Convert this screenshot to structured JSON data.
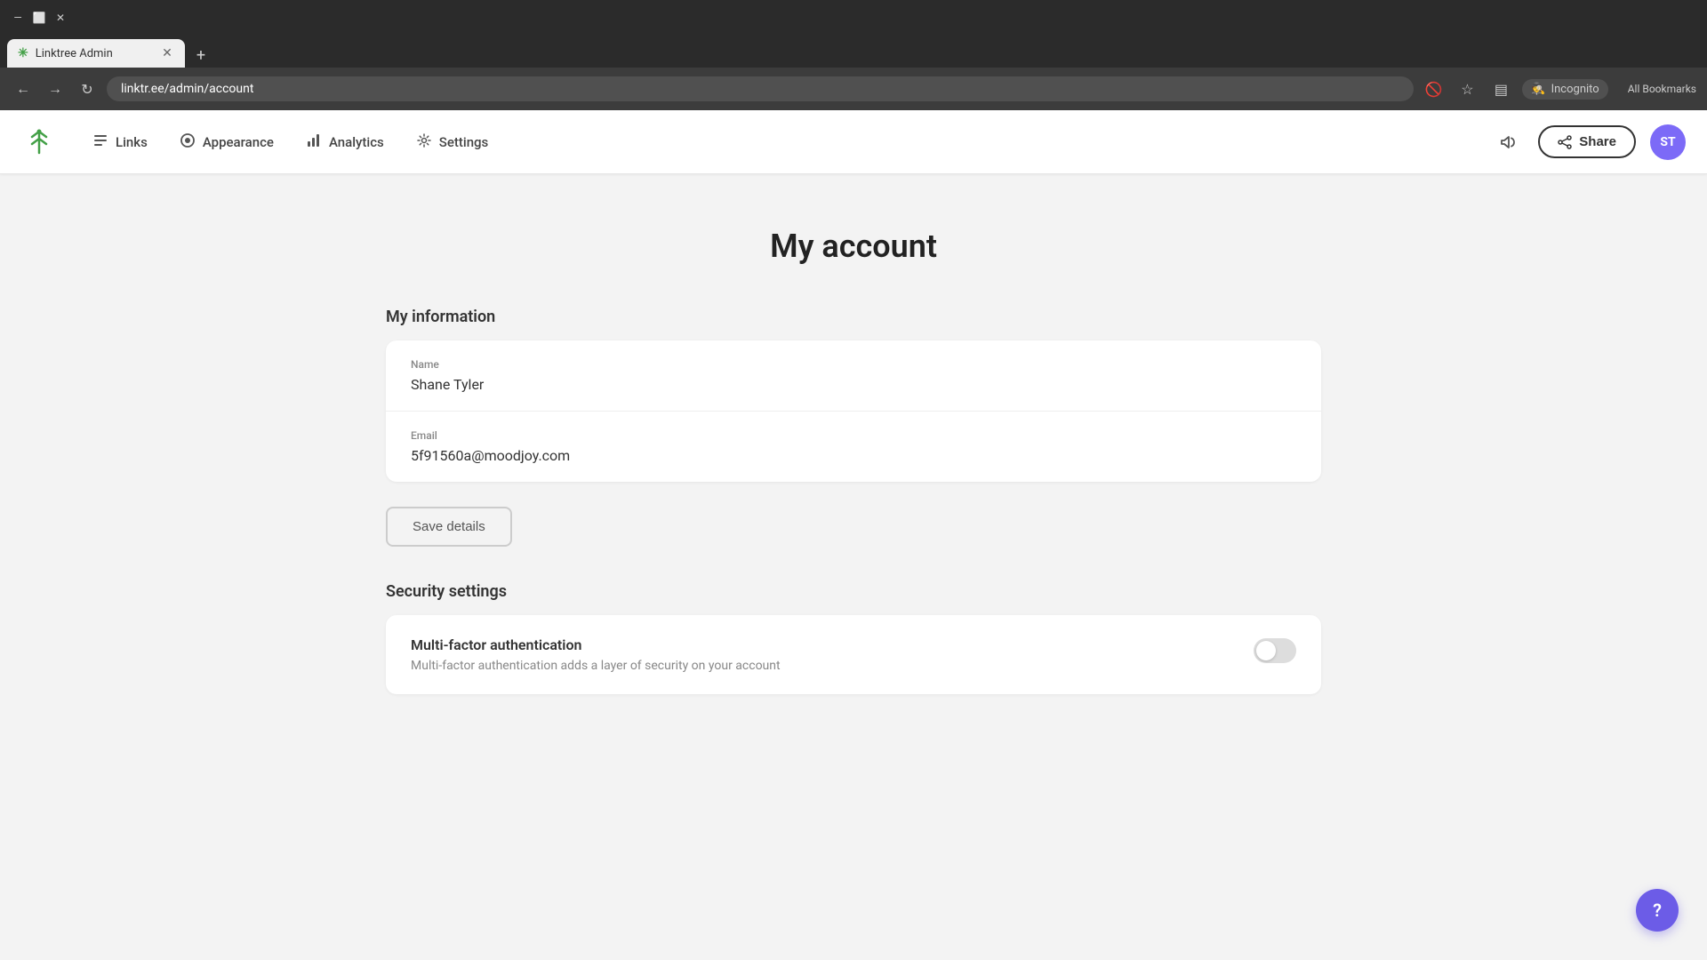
{
  "browser": {
    "tab_title": "Linktree Admin",
    "tab_favicon": "✳",
    "url": "linktr.ee/admin/account",
    "incognito_label": "Incognito"
  },
  "nav": {
    "logo_alt": "Linktree logo",
    "links": [
      {
        "id": "links",
        "label": "Links",
        "icon": "☰"
      },
      {
        "id": "appearance",
        "label": "Appearance",
        "icon": "◎"
      },
      {
        "id": "analytics",
        "label": "Analytics",
        "icon": "📊"
      },
      {
        "id": "settings",
        "label": "Settings",
        "icon": "⚙"
      }
    ],
    "share_label": "Share",
    "avatar_initials": "ST"
  },
  "page": {
    "title": "My account",
    "my_information": {
      "section_title": "My information",
      "name_label": "Name",
      "name_value": "Shane Tyler",
      "email_label": "Email",
      "email_value": "5f91560a@moodjoy.com",
      "save_button": "Save details"
    },
    "security": {
      "section_title": "Security settings",
      "mfa_title": "Multi-factor authentication",
      "mfa_description": "Multi-factor authentication adds a layer of security on your account",
      "mfa_enabled": false
    }
  },
  "help": {
    "icon": "?"
  }
}
